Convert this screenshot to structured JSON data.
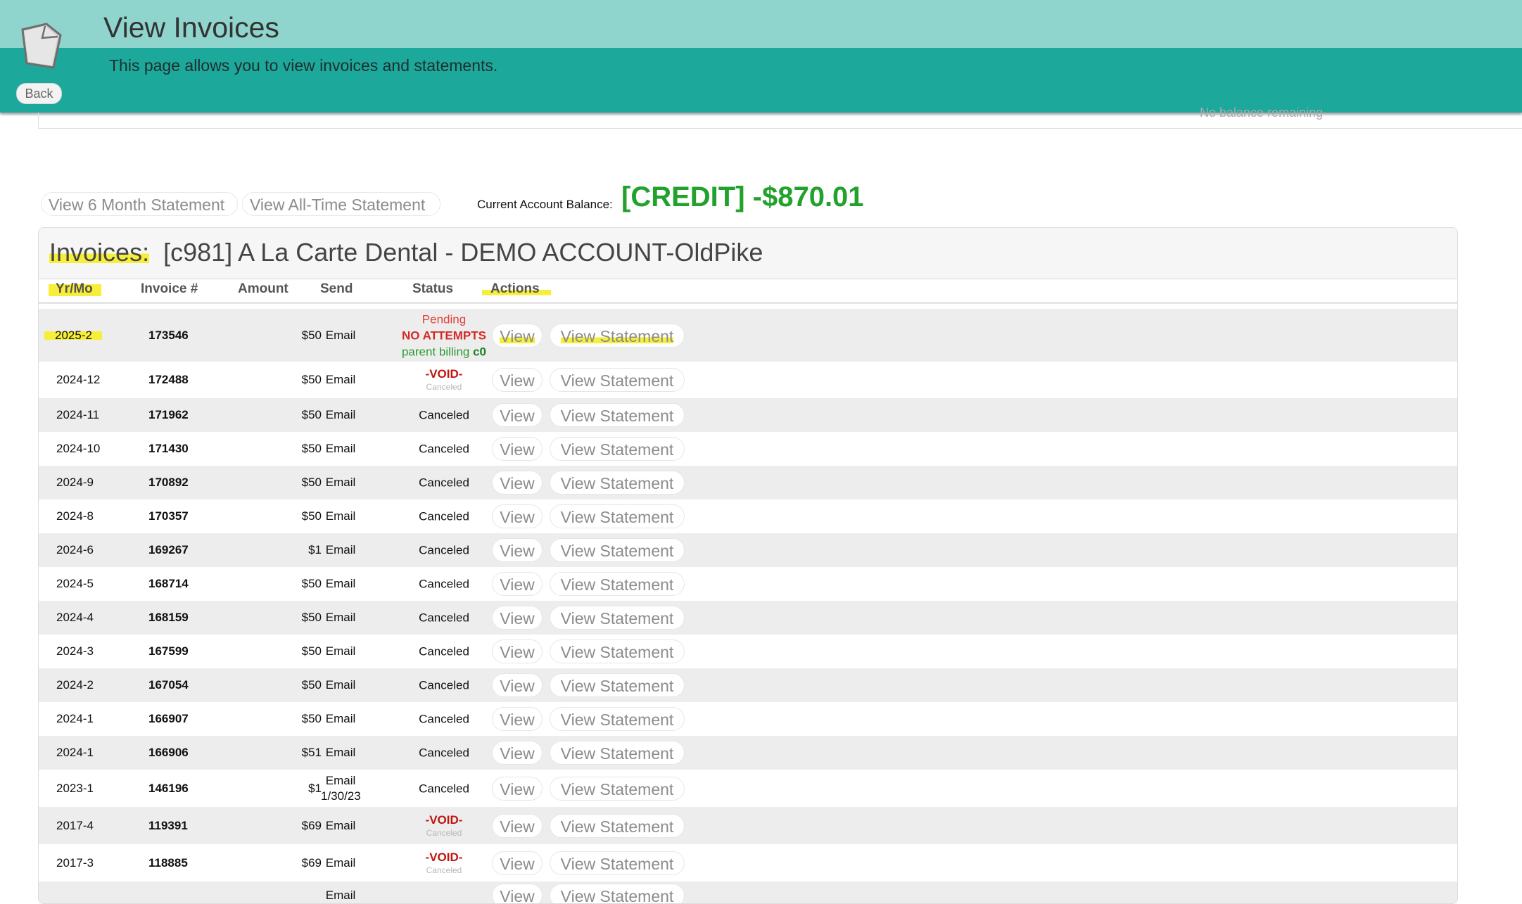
{
  "header": {
    "title": "View Invoices",
    "description": "This page allows you to view invoices and statements.",
    "back_label": "Back",
    "ghost_text": "No balance remaining"
  },
  "top_actions": {
    "six_month_label": "View 6 Month Statement",
    "all_time_label": "View All-Time Statement",
    "balance_label": "Current Account Balance:",
    "balance_value": "[CREDIT] -$870.01"
  },
  "panel": {
    "title": "Invoices:",
    "account": "[c981] A La Carte Dental - DEMO ACCOUNT-OldPike",
    "columns": {
      "yrmo": "Yr/Mo",
      "invoice": "Invoice #",
      "amount": "Amount",
      "send": "Send",
      "status": "Status",
      "actions": "Actions"
    },
    "action_labels": {
      "view": "View",
      "statement": "View Statement"
    }
  },
  "invoices": [
    {
      "yrmo": "2025-2",
      "invoice": "173546",
      "amount": "$50",
      "send": "Email",
      "send2": "",
      "status_type": "pending",
      "status1": "Pending",
      "status2": "NO ATTEMPTS",
      "status3": "parent billing ",
      "status3b": "c0"
    },
    {
      "yrmo": "2024-12",
      "invoice": "172488",
      "amount": "$50",
      "send": "Email",
      "send2": "",
      "status_type": "void",
      "status1": "-VOID-",
      "status2": "Canceled"
    },
    {
      "yrmo": "2024-11",
      "invoice": "171962",
      "amount": "$50",
      "send": "Email",
      "send2": "",
      "status_type": "plain",
      "status1": "Canceled"
    },
    {
      "yrmo": "2024-10",
      "invoice": "171430",
      "amount": "$50",
      "send": "Email",
      "send2": "",
      "status_type": "plain",
      "status1": "Canceled"
    },
    {
      "yrmo": "2024-9",
      "invoice": "170892",
      "amount": "$50",
      "send": "Email",
      "send2": "",
      "status_type": "plain",
      "status1": "Canceled"
    },
    {
      "yrmo": "2024-8",
      "invoice": "170357",
      "amount": "$50",
      "send": "Email",
      "send2": "",
      "status_type": "plain",
      "status1": "Canceled"
    },
    {
      "yrmo": "2024-6",
      "invoice": "169267",
      "amount": "$1",
      "send": "Email",
      "send2": "",
      "status_type": "plain",
      "status1": "Canceled"
    },
    {
      "yrmo": "2024-5",
      "invoice": "168714",
      "amount": "$50",
      "send": "Email",
      "send2": "",
      "status_type": "plain",
      "status1": "Canceled"
    },
    {
      "yrmo": "2024-4",
      "invoice": "168159",
      "amount": "$50",
      "send": "Email",
      "send2": "",
      "status_type": "plain",
      "status1": "Canceled"
    },
    {
      "yrmo": "2024-3",
      "invoice": "167599",
      "amount": "$50",
      "send": "Email",
      "send2": "",
      "status_type": "plain",
      "status1": "Canceled"
    },
    {
      "yrmo": "2024-2",
      "invoice": "167054",
      "amount": "$50",
      "send": "Email",
      "send2": "",
      "status_type": "plain",
      "status1": "Canceled"
    },
    {
      "yrmo": "2024-1",
      "invoice": "166907",
      "amount": "$50",
      "send": "Email",
      "send2": "",
      "status_type": "plain",
      "status1": "Canceled"
    },
    {
      "yrmo": "2024-1",
      "invoice": "166906",
      "amount": "$51",
      "send": "Email",
      "send2": "",
      "status_type": "plain",
      "status1": "Canceled"
    },
    {
      "yrmo": "2023-1",
      "invoice": "146196",
      "amount": "$1",
      "send": "Email",
      "send2": "1/30/23",
      "status_type": "plain",
      "status1": "Canceled"
    },
    {
      "yrmo": "2017-4",
      "invoice": "119391",
      "amount": "$69",
      "send": "Email",
      "send2": "",
      "status_type": "void",
      "status1": "-VOID-",
      "status2": "Canceled"
    },
    {
      "yrmo": "2017-3",
      "invoice": "118885",
      "amount": "$69",
      "send": "Email",
      "send2": "",
      "status_type": "void",
      "status1": "-VOID-",
      "status2": "Canceled"
    },
    {
      "yrmo": "",
      "invoice": "",
      "amount": "",
      "send": "Email",
      "send2": "",
      "status_type": "plain",
      "status1": ""
    }
  ],
  "colors": {
    "header_light": "#8fd5cd",
    "header_dark": "#1da89c",
    "balance_green": "#22a12c",
    "highlight": "#f7ee3a"
  }
}
